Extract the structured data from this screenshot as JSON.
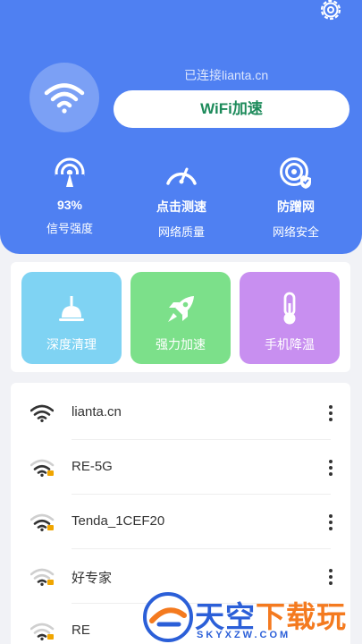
{
  "header": {
    "connected_text": "已连接lianta.cn",
    "accelerate_label": "WiFi加速",
    "stats": [
      {
        "value": "93%",
        "label": "信号强度",
        "icon": "signal-icon"
      },
      {
        "value": "点击测速",
        "label": "网络质量",
        "icon": "speedometer-icon"
      },
      {
        "value": "防蹭网",
        "label": "网络安全",
        "icon": "shield-wifi-icon"
      }
    ]
  },
  "tools": [
    {
      "label": "深度清理",
      "color": "#7fd3f3",
      "icon": "broom-icon"
    },
    {
      "label": "强力加速",
      "color": "#7ce08a",
      "icon": "rocket-icon"
    },
    {
      "label": "手机降温",
      "color": "#c88ff0",
      "icon": "thermometer-icon"
    }
  ],
  "wifi_list": [
    {
      "name": "lianta.cn"
    },
    {
      "name": "RE-5G"
    },
    {
      "name": "Tenda_1CEF20"
    },
    {
      "name": "好专家"
    },
    {
      "name": "RE"
    }
  ],
  "watermark": {
    "brand_part1": "天空",
    "brand_part2": "下载玩",
    "domain": "SKYXZW.COM"
  }
}
